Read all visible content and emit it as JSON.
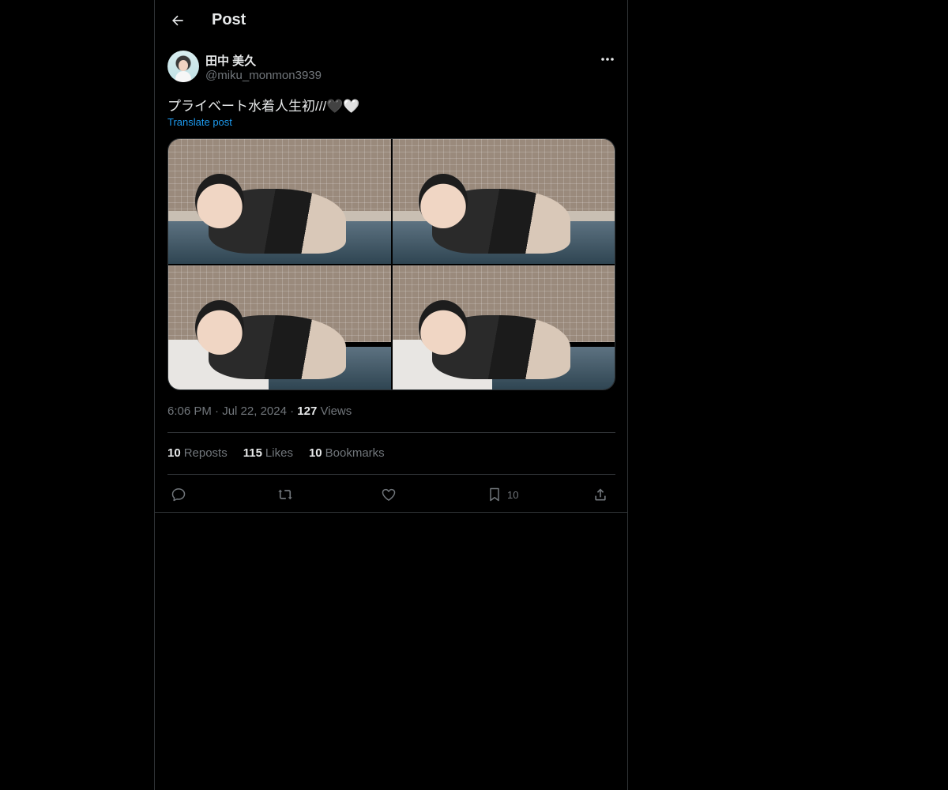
{
  "header": {
    "title": "Post"
  },
  "author": {
    "display_name": "田中 美久",
    "handle": "@miku_monmon3939"
  },
  "post": {
    "text": "プライベート水着人生初///🖤🤍",
    "translate_label": "Translate post",
    "time": "6:06 PM",
    "date": "Jul 22, 2024",
    "views_count": "127",
    "views_label": "Views",
    "separator": "·"
  },
  "stats": {
    "reposts_count": "10",
    "reposts_label": "Reposts",
    "likes_count": "115",
    "likes_label": "Likes",
    "bookmarks_count": "10",
    "bookmarks_label": "Bookmarks"
  },
  "actions": {
    "bookmark_count": "10",
    "icons": [
      "reply-icon",
      "repost-icon",
      "like-icon",
      "bookmark-icon",
      "share-icon"
    ]
  },
  "colors": {
    "background": "#000000",
    "text_primary": "#e7e9ea",
    "text_secondary": "#71767b",
    "link": "#1d9bf0",
    "border": "#2f3336"
  }
}
